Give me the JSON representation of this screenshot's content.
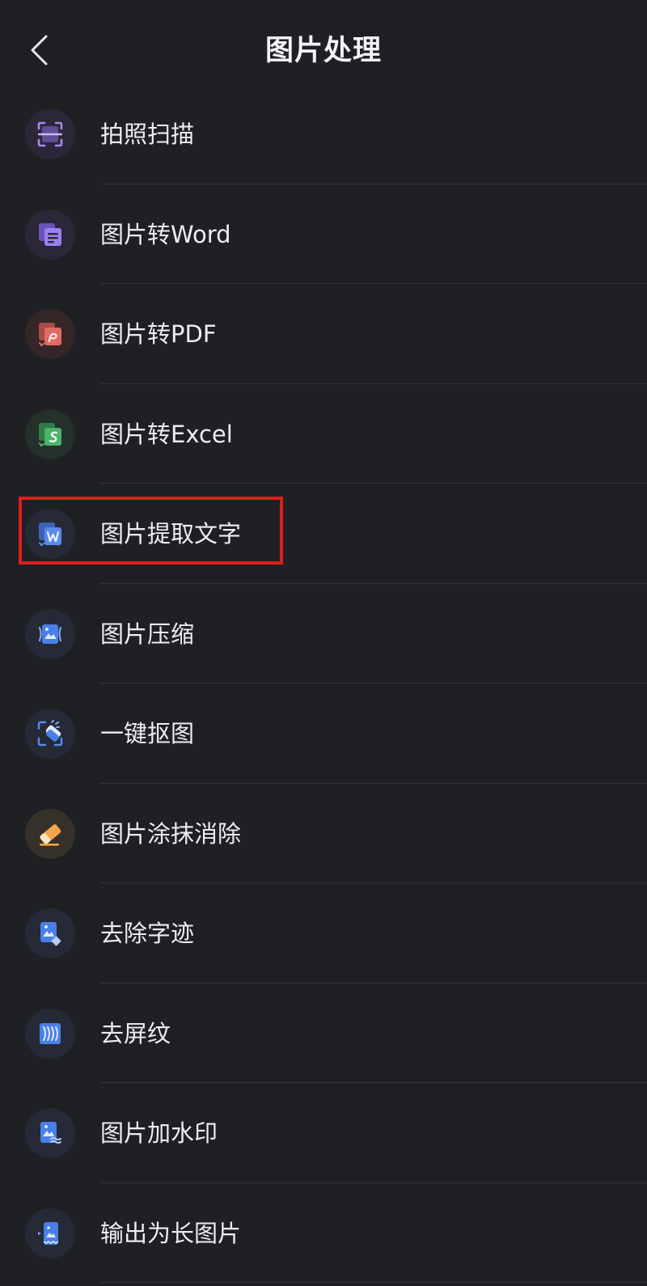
{
  "header": {
    "title": "图片处理",
    "back_icon": "chevron-left-icon"
  },
  "colors": {
    "background": "#1f2024",
    "divider": "#34353a",
    "highlight": "#e01d1d",
    "purple": "#8a6fe0",
    "red": "#d9534f",
    "green": "#3fa65a",
    "blue": "#4a7fe8",
    "orange": "#e89a3c"
  },
  "items": [
    {
      "label": "拍照扫描",
      "icon": "scan-icon"
    },
    {
      "label": "图片转Word",
      "icon": "image-to-word-icon"
    },
    {
      "label": "图片转PDF",
      "icon": "image-to-pdf-icon"
    },
    {
      "label": "图片转Excel",
      "icon": "image-to-excel-icon"
    },
    {
      "label": "图片提取文字",
      "icon": "extract-text-icon"
    },
    {
      "label": "图片压缩",
      "icon": "compress-image-icon"
    },
    {
      "label": "一键抠图",
      "icon": "cutout-icon"
    },
    {
      "label": "图片涂抹消除",
      "icon": "eraser-icon"
    },
    {
      "label": "去除字迹",
      "icon": "remove-handwriting-icon"
    },
    {
      "label": "去屏纹",
      "icon": "remove-moire-icon"
    },
    {
      "label": "图片加水印",
      "icon": "watermark-icon"
    },
    {
      "label": "输出为长图片",
      "icon": "long-image-icon"
    }
  ]
}
